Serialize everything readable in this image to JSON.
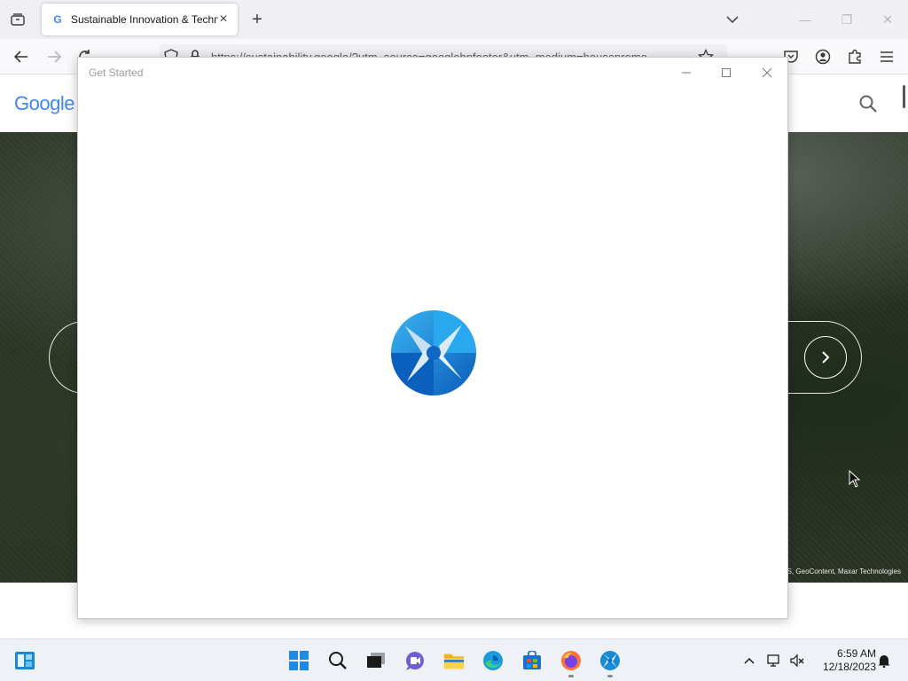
{
  "browser": {
    "tab": {
      "favicon": "G",
      "title": "Sustainable Innovation & Techn"
    },
    "url": "https://sustainability.google/?utm_source=googlehpfooter&utm_medium=housepromo",
    "icons": [
      "tab-list-icon",
      "close-icon",
      "plus-icon",
      "chevron-down-icon",
      "minimize-icon",
      "maximize-icon",
      "back-arrow-icon",
      "forward-arrow-icon",
      "reload-icon",
      "shield-icon",
      "lock-icon",
      "star-icon",
      "pocket-icon",
      "account-icon",
      "extensions-icon",
      "menu-icon"
    ]
  },
  "page": {
    "logo": "Google",
    "attribution": "S, GeoContent, Maxar Technologies"
  },
  "dialog": {
    "title": "Get Started",
    "icons": [
      "minimize-icon",
      "maximize-icon",
      "close-icon",
      "get-started-logo-icon"
    ]
  },
  "taskbar": {
    "time": "6:59 AM",
    "date": "12/18/2023",
    "icons": [
      "widgets-icon",
      "start-icon",
      "search-icon",
      "task-view-icon",
      "teams-chat-icon",
      "file-explorer-icon",
      "edge-icon",
      "store-icon",
      "firefox-icon",
      "get-started-icon",
      "chevron-up-icon",
      "network-icon",
      "volume-muted-icon",
      "notification-icon"
    ]
  },
  "colors": {
    "accent_blue": "#0078d4",
    "taskbar_bg": "#eef2f7",
    "hero_bg": "#2b3424"
  }
}
